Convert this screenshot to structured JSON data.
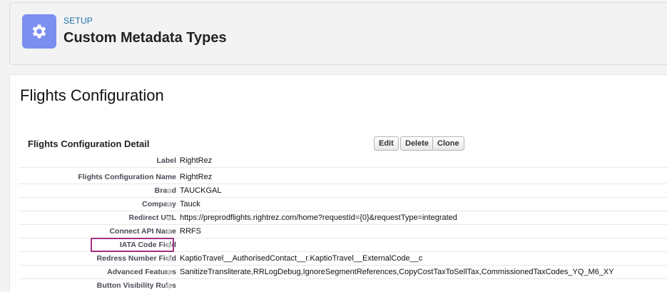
{
  "header": {
    "eyebrow": "SETUP",
    "title": "Custom Metadata Types",
    "icon": "gear-icon"
  },
  "page": {
    "title": "Flights Configuration",
    "detail_title": "Flights Configuration Detail",
    "buttons": {
      "edit": "Edit",
      "delete": "Delete",
      "clone": "Clone"
    }
  },
  "fields": [
    {
      "label": "Label",
      "value": "RightRez",
      "help": false
    },
    {
      "label": "Flights Configuration Name",
      "value": "RightRez",
      "help": false
    },
    {
      "label": "Brand",
      "value": "TAUCKGAL",
      "help": true
    },
    {
      "label": "Company",
      "value": "Tauck",
      "help": true
    },
    {
      "label": "Redirect URL",
      "value": "https://preprodflights.rightrez.com/home?requestId={0}&requestType=integrated",
      "help": true
    },
    {
      "label": "Connect API Name",
      "value": "RRFS",
      "help": true
    },
    {
      "label": "IATA Code Field",
      "value": "",
      "help": true
    },
    {
      "label": "Redress Number Field",
      "value": "KaptioTravel__AuthorisedContact__r.KaptioTravel__ExternalCode__c",
      "help": true
    },
    {
      "label": "Advanced Features",
      "value": "SanitizeTransliterate,RRLogDebug,IgnoreSegmentReferences,CopyCostTaxToSellTax,CommissionedTaxCodes_YQ_M6_XY",
      "help": true
    },
    {
      "label": "Button Visibility Rules",
      "value": "",
      "help": true
    }
  ],
  "colors": {
    "accent_icon": "#7b8ff0",
    "highlight": "#a0317e",
    "link": "#1a6ea8"
  }
}
